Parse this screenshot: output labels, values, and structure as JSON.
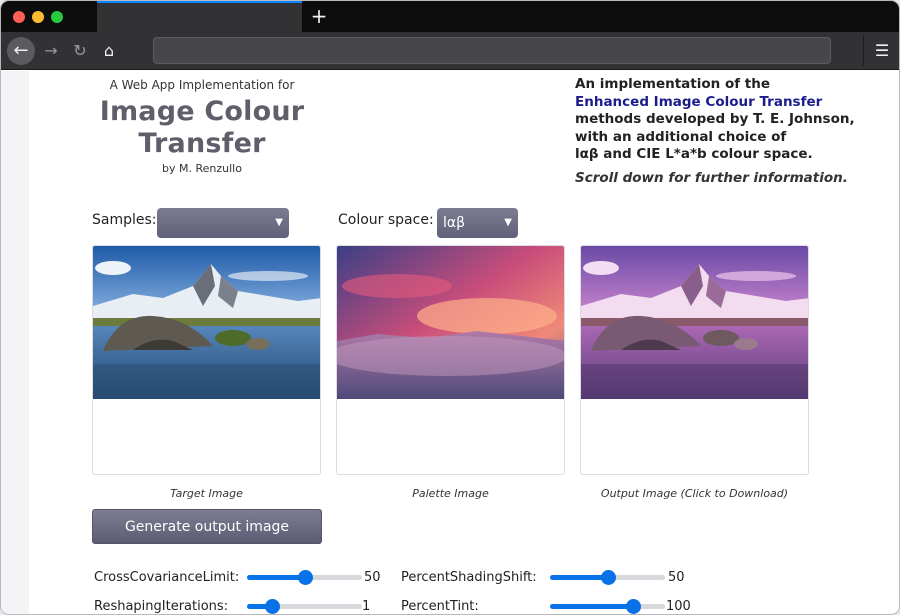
{
  "window": {
    "new_tab_glyph": "+"
  },
  "nav": {
    "back_icon": "←",
    "forward_icon": "→",
    "reload_icon": "↻",
    "home_icon": "⌂",
    "menu_icon": "☰",
    "url": ""
  },
  "hero": {
    "subtitle": "A Web App Implementation for",
    "title_line1": "Image Colour",
    "title_line2": "Transfer",
    "author": "by M. Renzullo"
  },
  "description": {
    "line1": "An implementation of the",
    "link": "Enhanced Image Colour Transfer",
    "line3": "methods developed by T. E. Johnson,",
    "line4": "with an additional choice of",
    "line5": "lαβ and CIE L*a*b colour space.",
    "scroll_note": "Scroll down for further information."
  },
  "controls": {
    "samples_label": "Samples:",
    "samples_value": "",
    "colour_space_label": "Colour space:",
    "colour_space_value": "lαβ"
  },
  "images": {
    "target_caption": "Target Image",
    "palette_caption": "Palette Image",
    "output_caption": "Output Image (Click to Download)"
  },
  "generate_button": "Generate output image",
  "sliders": [
    {
      "label": "CrossCovarianceLimit:",
      "value": 50,
      "fraction": 0.5
    },
    {
      "label": "PercentShadingShift:",
      "value": 50,
      "fraction": 0.5
    },
    {
      "label": "ReshapingIterations:",
      "value": 1,
      "fraction": 0.22
    },
    {
      "label": "PercentTint:",
      "value": 100,
      "fraction": 0.72
    }
  ],
  "colors": {
    "accent": "#0a72e8",
    "button": "#6a6a82",
    "link": "#1c1c8c"
  }
}
